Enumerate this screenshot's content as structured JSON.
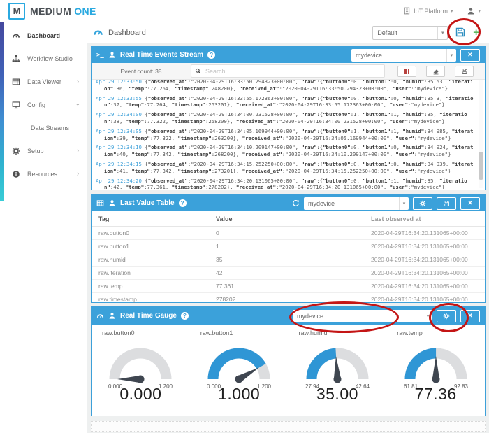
{
  "brand": {
    "logo_letter": "M",
    "name_primary": "MEDIUM",
    "name_secondary": "ONE"
  },
  "topbar": {
    "platform_label": "IoT Platform"
  },
  "subheader": {
    "title": "Dashboard",
    "dashboard_name": "Default",
    "plus_label": "+"
  },
  "sidebar": {
    "items": [
      {
        "label": "Dashboard",
        "icon": "gauge",
        "active": true,
        "chevron": "none",
        "sub": false
      },
      {
        "label": "Workflow Studio",
        "icon": "sitemap",
        "active": false,
        "chevron": "none",
        "sub": false
      },
      {
        "label": "Data Viewer",
        "icon": "table",
        "active": false,
        "chevron": "right",
        "sub": false
      },
      {
        "label": "Config",
        "icon": "monitor",
        "active": false,
        "chevron": "down",
        "sub": false
      },
      {
        "label": "Data Streams",
        "icon": "",
        "active": false,
        "chevron": "none",
        "sub": true
      },
      {
        "label": "Setup",
        "icon": "gear",
        "active": false,
        "chevron": "right",
        "sub": false
      },
      {
        "label": "Resources",
        "icon": "info",
        "active": false,
        "chevron": "right",
        "sub": false
      }
    ]
  },
  "events": {
    "title": "Real Time Events Stream",
    "device": "mydevice",
    "count_label": "Event count: 38",
    "search_placeholder": "Search",
    "entries": [
      {
        "time": "Apr 29 12:33:50",
        "json": "{\"observed_at\":\"2020-04-29T16:33:50.294323+00:00\", \"raw\":{\"button0\":0, \"button1\":0, \"humid\":35.53, \"iteration\":36, \"temp\":77.264, \"timestamp\":248200}, \"received_at\":\"2020-04-29T16:33:50.294323+00:00\", \"user\":\"mydevice\"}"
      },
      {
        "time": "Apr 29 12:33:55",
        "json": "{\"observed_at\":\"2020-04-29T16:33:55.172363+00:00\", \"raw\":{\"button0\":0, \"button1\":0, \"humid\":35.3, \"iteration\":37, \"temp\":77.264, \"timestamp\":253201}, \"received_at\":\"2020-04-29T16:33:55.172363+00:00\", \"user\":\"mydevice\"}"
      },
      {
        "time": "Apr 29 12:34:00",
        "json": "{\"observed_at\":\"2020-04-29T16:34:00.231528+00:00\", \"raw\":{\"button0\":1, \"button1\":1, \"humid\":35, \"iteration\":38, \"temp\":77.322, \"timestamp\":258200}, \"received_at\":\"2020-04-29T16:34:00.231528+00:00\", \"user\":\"mydevice\"}"
      },
      {
        "time": "Apr 29 12:34:05",
        "json": "{\"observed_at\":\"2020-04-29T16:34:05.169944+00:00\", \"raw\":{\"button0\":1, \"button1\":1, \"humid\":34.985, \"iteration\":39, \"temp\":77.322, \"timestamp\":263200}, \"received_at\":\"2020-04-29T16:34:05.169944+00:00\", \"user\":\"mydevice\"}"
      },
      {
        "time": "Apr 29 12:34:10",
        "json": "{\"observed_at\":\"2020-04-29T16:34:10.209147+00:00\", \"raw\":{\"button0\":0, \"button1\":0, \"humid\":34.924, \"iteration\":40, \"temp\":77.342, \"timestamp\":268200}, \"received_at\":\"2020-04-29T16:34:10.209147+00:00\", \"user\":\"mydevice\"}"
      },
      {
        "time": "Apr 29 12:34:15",
        "json": "{\"observed_at\":\"2020-04-29T16:34:15.252250+00:00\", \"raw\":{\"button0\":0, \"button1\":0, \"humid\":34.939, \"iteration\":41, \"temp\":77.342, \"timestamp\":273201}, \"received_at\":\"2020-04-29T16:34:15.252250+00:00\", \"user\":\"mydevice\"}"
      },
      {
        "time": "Apr 29 12:34:20",
        "json": "{\"observed_at\":\"2020-04-29T16:34:20.131065+00:00\", \"raw\":{\"button0\":0, \"button1\":1, \"humid\":35, \"iteration\":42, \"temp\":77.361, \"timestamp\":278202}, \"received_at\":\"2020-04-29T16:34:20.131065+00:00\", \"user\":\"mydevice\"}"
      }
    ]
  },
  "last_value": {
    "title": "Last Value Table",
    "device": "mydevice",
    "columns": [
      "Tag",
      "Value",
      "Last observed at"
    ],
    "rows": [
      {
        "tag": "raw.button0",
        "value": "0",
        "last": "2020-04-29T16:34:20.131065+00:00"
      },
      {
        "tag": "raw.button1",
        "value": "1",
        "last": "2020-04-29T16:34:20.131065+00:00"
      },
      {
        "tag": "raw.humid",
        "value": "35",
        "last": "2020-04-29T16:34:20.131065+00:00"
      },
      {
        "tag": "raw.iteration",
        "value": "42",
        "last": "2020-04-29T16:34:20.131065+00:00"
      },
      {
        "tag": "raw.temp",
        "value": "77.361",
        "last": "2020-04-29T16:34:20.131065+00:00"
      },
      {
        "tag": "raw.timestamp",
        "value": "278202",
        "last": "2020-04-29T16:34:20.131065+00:00"
      }
    ]
  },
  "gauge_widget": {
    "title": "Real Time Gauge",
    "device": "mydevice"
  },
  "chart_data": {
    "type": "gauge-set",
    "title": "Real Time Gauge",
    "items": [
      {
        "tag": "raw.button0",
        "min": "0.000",
        "max": "1.200",
        "value": "0.000",
        "fraction": 0.0
      },
      {
        "tag": "raw.button1",
        "min": "0.000",
        "max": "1.200",
        "value": "1.000",
        "fraction": 0.833
      },
      {
        "tag": "raw.humid",
        "min": "27.94",
        "max": "42.64",
        "value": "35.00",
        "fraction": 0.48
      },
      {
        "tag": "raw.temp",
        "min": "61.81",
        "max": "92.83",
        "value": "77.36",
        "fraction": 0.5
      }
    ]
  },
  "colors": {
    "accent": "#3ba1da",
    "gauge_blue": "#2f96d5",
    "gauge_gray": "#dcdddf",
    "needle": "#3f4650",
    "annotation": "#c41515",
    "brand_blue": "#2aa9e0",
    "pause_red": "#b8423e",
    "plus_green": "#5cb85c",
    "timestamp_blue": "#3da0d9"
  }
}
